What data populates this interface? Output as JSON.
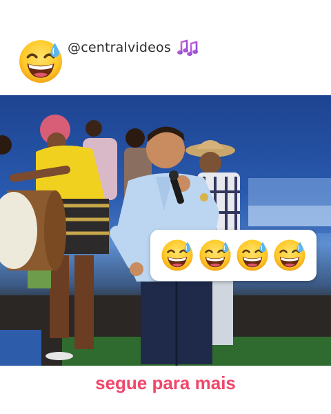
{
  "header": {
    "handle": "@centralvideos",
    "emoji_icon": "grinning-sweat-emoji",
    "notes_icon": "music-notes-emoji"
  },
  "video": {
    "description_icon": "video-frame",
    "sticker_emojis": [
      "grinning-sweat-emoji",
      "grinning-sweat-emoji",
      "grinning-sweat-emoji",
      "grinning-sweat-emoji"
    ]
  },
  "footer": {
    "cta": "segue para mais"
  },
  "colors": {
    "cta": "#f0466a",
    "emoji_face": "#ffcc33",
    "sweat": "#5bb6f0"
  }
}
